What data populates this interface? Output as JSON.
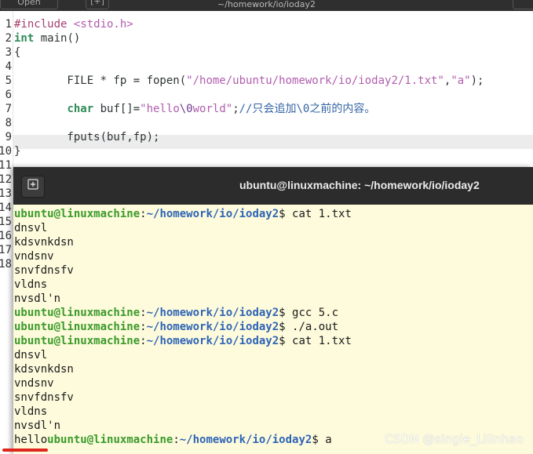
{
  "editor": {
    "title": "~/homework/io/ioday2",
    "open_label": "Open",
    "gutter": [
      "1",
      "2",
      "3",
      "4",
      "5",
      "6",
      "7",
      "8",
      "9",
      "10",
      "11",
      "12",
      "13",
      "14",
      "15",
      "16",
      "17",
      "18"
    ],
    "lines": {
      "l1_a": "#include ",
      "l1_b": "<stdio.h>",
      "l2_a": "int",
      "l2_b": " main()",
      "l3": "{",
      "l5_a": "        FILE * fp = fopen(",
      "l5_b": "\"/home/ubuntu/homework/io/ioday2/1.txt\"",
      "l5_c": ",",
      "l5_d": "\"a\"",
      "l5_e": ");",
      "l7_a": "        ",
      "l7_b": "char",
      "l7_c": " buf[]=",
      "l7_d": "\"hello",
      "l7_e": "\\0",
      "l7_f": "world\"",
      "l7_g": ";",
      "l7_h": "//只会追加\\0之前的内容。",
      "l9": "        fputs(buf,fp);",
      "l10": "}"
    }
  },
  "terminal": {
    "title": "ubuntu@linuxmachine: ~/homework/io/ioday2",
    "new_tab_icon": "+",
    "user": "ubuntu@linuxmachine",
    "path": "~/homework/io/ioday2",
    "colon": ":",
    "prompt_end": "$ ",
    "cmd_cat": "cat 1.txt",
    "cmd_gcc": "gcc 5.c",
    "cmd_run": "./a.out",
    "cmd_last": "a",
    "out": [
      "dnsvl",
      "kdsvnkdsn",
      "vndsnv",
      "snvfdnsfv",
      "vldns",
      "nvsdl'n"
    ],
    "hello": "hello"
  },
  "watermark": "CSDN @single_Lilinhao"
}
